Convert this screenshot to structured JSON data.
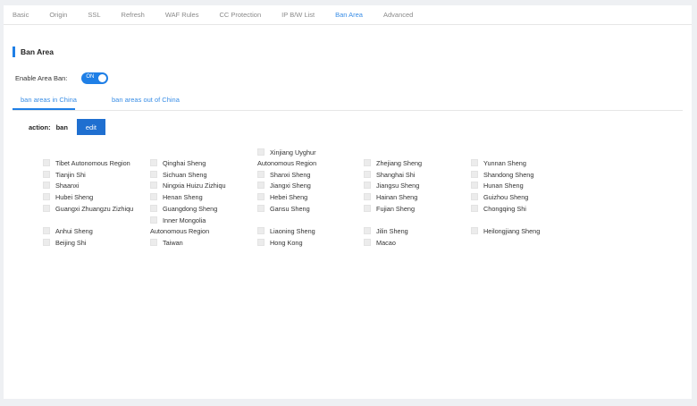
{
  "top_tabs": [
    "Basic",
    "Origin",
    "SSL",
    "Refresh",
    "WAF Rules",
    "CC Protection",
    "IP B/W List",
    "Ban Area",
    "Advanced"
  ],
  "active_tab": "Ban Area",
  "section_title": "Ban Area",
  "enable_label": "Enable Area Ban:",
  "toggle_text": "ON",
  "sub_tabs": [
    "ban areas in China",
    "ban areas out of China"
  ],
  "action_label": "action:",
  "action_value": "ban",
  "edit_label": "edit",
  "colors": {
    "accent": "#1f7fe6",
    "tab_active": "#3a8ee6",
    "button": "#1f6fd0"
  },
  "regions": {
    "col1": [
      "Tibet Autonomous Region",
      "Tianjin Shi",
      "Shaanxi",
      "Hubei Sheng",
      "Guangxi Zhuangzu Zizhiqu",
      "Anhui Sheng",
      "Beijing Shi"
    ],
    "col2": [
      "Qinghai Sheng",
      "Sichuan Sheng",
      "Ningxia Huizu Zizhiqu",
      "Henan Sheng",
      "Guangdong Sheng",
      "Inner Mongolia",
      "Autonomous Region",
      "Taiwan"
    ],
    "col3": [
      "Xinjiang Uyghur",
      "Autonomous Region",
      "Shanxi Sheng",
      "Jiangxi Sheng",
      "Hebei Sheng",
      "Gansu Sheng",
      "Liaoning Sheng",
      "Hong Kong"
    ],
    "col4": [
      "Zhejiang Sheng",
      "Shanghai Shi",
      "Jiangsu Sheng",
      "Hainan Sheng",
      "Fujian Sheng",
      "Jilin Sheng",
      "Macao"
    ],
    "col5": [
      "Yunnan Sheng",
      "Shandong Sheng",
      "Hunan Sheng",
      "Guizhou Sheng",
      "Chongqing Shi",
      "Heilongjiang Sheng"
    ]
  }
}
